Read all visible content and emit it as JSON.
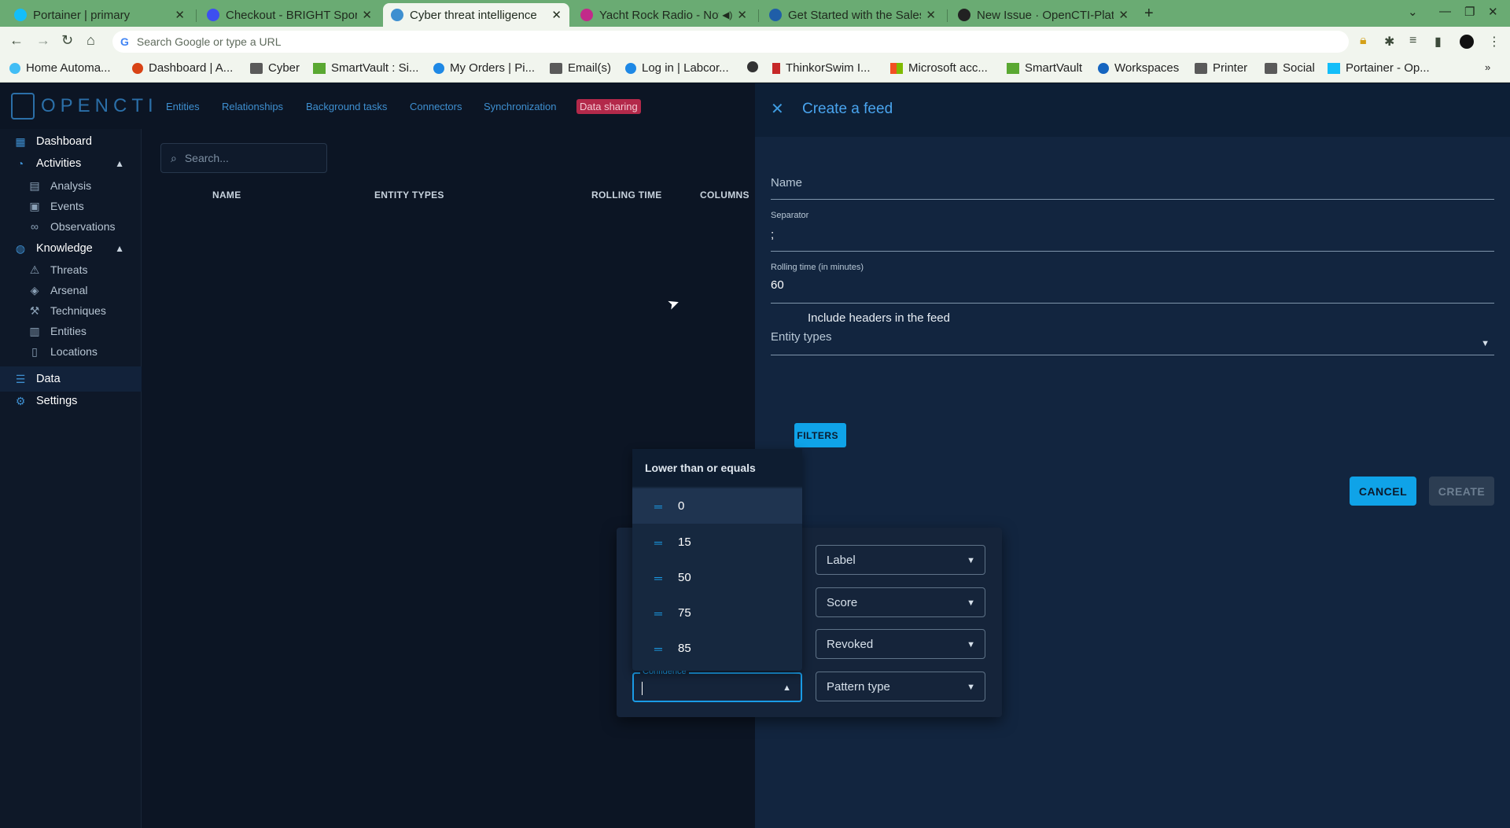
{
  "browser": {
    "tabs": [
      {
        "title": "Portainer | primary",
        "active": false,
        "favicon_color": "#13bef9"
      },
      {
        "title": "Checkout - BRIGHT Sport",
        "active": false,
        "favicon_color": "#3d4ff0"
      },
      {
        "title": "Cyber threat intelligence",
        "active": true,
        "favicon_color": "#3e8fd0"
      },
      {
        "title": "Yacht Rock Radio - Now",
        "active": false,
        "favicon_color": "#c22a8a"
      },
      {
        "title": "Get Started with the Sales",
        "active": false,
        "favicon_color": "#1f5ea8"
      },
      {
        "title": "New Issue · OpenCTI-Platf",
        "active": false,
        "favicon_color": "#222222"
      }
    ],
    "omnibox_placeholder": "Search Google or type a URL",
    "bookmarks": [
      {
        "label": "Home Automa...",
        "icon": "home-assistant-icon",
        "color": "#41bdf5"
      },
      {
        "label": "Dashboard | A...",
        "icon": "dashboard-icon",
        "color": "#d84315"
      },
      {
        "label": "Cyber",
        "icon": "folder-icon",
        "color": "#5a5a5a"
      },
      {
        "label": "SmartVault : Si...",
        "icon": "smartvault-icon",
        "color": "#5aa832"
      },
      {
        "label": "My Orders | Pi...",
        "icon": "orders-icon",
        "color": "#1e88e5"
      },
      {
        "label": "Email(s)",
        "icon": "folder-icon",
        "color": "#5a5a5a"
      },
      {
        "label": "Log in | Labcor...",
        "icon": "labcorp-icon",
        "color": "#1e88e5"
      },
      {
        "label": "",
        "icon": "globe-icon",
        "color": "#333333"
      },
      {
        "label": "ThinkorSwim I...",
        "icon": "thinkorswim-icon",
        "color": "#c62828"
      },
      {
        "label": "Microsoft acc...",
        "icon": "microsoft-icon",
        "color": "#f25022"
      },
      {
        "label": "SmartVault",
        "icon": "smartvault-icon",
        "color": "#5aa832"
      },
      {
        "label": "Workspaces",
        "icon": "workspaces-icon",
        "color": "#1565c0"
      },
      {
        "label": "Printer",
        "icon": "folder-icon",
        "color": "#5a5a5a"
      },
      {
        "label": "Social",
        "icon": "folder-icon",
        "color": "#5a5a5a"
      },
      {
        "label": "Portainer - Op...",
        "icon": "portainer-icon",
        "color": "#13bef9"
      }
    ]
  },
  "app": {
    "logo_text": "OPENCTI",
    "topnav": [
      "Entities",
      "Relationships",
      "Background tasks",
      "Connectors",
      "Synchronization",
      "Data sharing"
    ],
    "sidebar": {
      "dashboard": "Dashboard",
      "activities": "Activities",
      "analysis": "Analysis",
      "events": "Events",
      "observations": "Observations",
      "knowledge": "Knowledge",
      "threats": "Threats",
      "arsenal": "Arsenal",
      "techniques": "Techniques",
      "entities": "Entities",
      "locations": "Locations",
      "data": "Data",
      "settings": "Settings"
    },
    "search_placeholder": "Search...",
    "columns": [
      "NAME",
      "ENTITY TYPES",
      "ROLLING TIME",
      "COLUMNS"
    ]
  },
  "drawer": {
    "title": "Create a feed",
    "name_label": "Name",
    "separator_label": "Separator",
    "separator_value": ";",
    "rolling_label": "Rolling time (in minutes)",
    "rolling_value": "60",
    "entity_types_label": "Entity types",
    "headers_label": "Include headers in the feed",
    "filters_button": "FILTERS",
    "cancel": "CANCEL",
    "create": "CREATE"
  },
  "filters": {
    "label": "Label",
    "score": "Score",
    "revoked": "Revoked",
    "pattern_type": "Pattern type",
    "confidence_label": "Confidence",
    "dropdown_group": "Lower than or equals",
    "dropdown_options": [
      "0",
      "15",
      "50",
      "75",
      "85"
    ]
  }
}
